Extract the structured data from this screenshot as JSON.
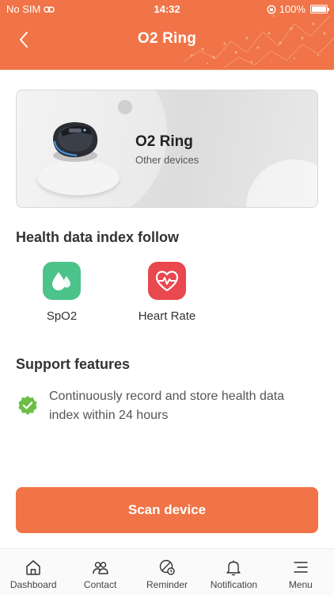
{
  "status_bar": {
    "carrier": "No SIM",
    "time": "14:32",
    "battery": "100%"
  },
  "nav": {
    "title": "O2 Ring"
  },
  "device": {
    "name": "O2 Ring",
    "subtitle": "Other devices"
  },
  "health_index": {
    "title": "Health data index follow",
    "items": [
      {
        "label": "SpO2",
        "icon": "water-drops-icon",
        "color": "#4CC38A"
      },
      {
        "label": "Heart Rate",
        "icon": "heart-pulse-icon",
        "color": "#E8484E"
      }
    ]
  },
  "support": {
    "title": "Support features",
    "features": [
      {
        "text": "Continuously record and store health data index within 24 hours",
        "icon": "check-badge-icon",
        "color": "#6DBE45"
      }
    ]
  },
  "actions": {
    "scan_label": "Scan device"
  },
  "tabbar": {
    "items": [
      {
        "label": "Dashboard",
        "icon": "home-icon"
      },
      {
        "label": "Contact",
        "icon": "contacts-icon"
      },
      {
        "label": "Reminder",
        "icon": "pill-reminder-icon"
      },
      {
        "label": "Notification",
        "icon": "bell-icon"
      },
      {
        "label": "Menu",
        "icon": "menu-icon"
      }
    ]
  },
  "colors": {
    "brand": "#F07447"
  }
}
